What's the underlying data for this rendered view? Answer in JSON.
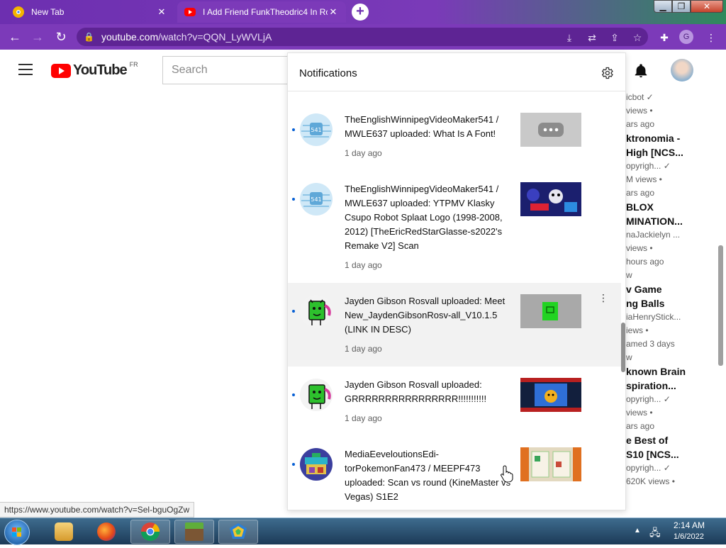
{
  "browser": {
    "tabs": [
      {
        "title": "New Tab",
        "favicon": "chrome-newtab-icon"
      },
      {
        "title": "I Add Friend FunkTheodric4 In Ro",
        "favicon": "youtube-icon"
      }
    ],
    "url_prefix": "youtube.com",
    "url_path": "/watch?v=QQN_LyWVLjA",
    "profile_initial": "G",
    "accent": "#7c3ab9"
  },
  "youtube": {
    "logo_text": "YouTube",
    "country_code": "FR",
    "search_placeholder": "Search"
  },
  "notifications": {
    "title": "Notifications",
    "items": [
      {
        "text": "TheEnglishWinnipegVideoMaker541 / MWLE637 uploaded: What Is A Font!",
        "time": "1 day ago",
        "channel_icon": "globe-channel-icon",
        "thumb_icon": "ellipsis-placeholder-icon"
      },
      {
        "text": "TheEnglishWinnipegVideoMaker541 / MWLE637 uploaded: YTPMV Klasky Csupo Robot Splaat Logo (1998-2008, 2012) [TheEricRedStarGlasse-s2022's Remake V2] Scan",
        "time": "1 day ago",
        "channel_icon": "globe-channel-icon",
        "thumb_icon": "video-thumbnail"
      },
      {
        "text": "Jayden Gibson Rosvall uploaded: Meet New_JaydenGibsonRosv-all_V10.1.5 (LINK IN DESC)",
        "time": "1 day ago",
        "channel_icon": "green-character-channel-icon",
        "thumb_icon": "video-thumbnail"
      },
      {
        "text": "Jayden Gibson Rosvall uploaded: GRRRRRRRRRRRRRRRR!!!!!!!!!!!",
        "time": "1 day ago",
        "channel_icon": "green-character-channel-icon",
        "thumb_icon": "video-thumbnail"
      },
      {
        "text": "MediaEeveloutionsEdi-torPokemonFan473 / MEEPF473 uploaded: Scan vs round (KineMaster vs Vegas) S1E2",
        "time": "",
        "channel_icon": "pixel-art-channel-icon",
        "thumb_icon": "video-thumbnail"
      }
    ]
  },
  "recommendations": [
    {
      "line": "icbot ✓",
      "kind": "meta"
    },
    {
      "line": "views •",
      "kind": "meta"
    },
    {
      "line": "ars ago",
      "kind": "meta"
    },
    {
      "line": "ktronomia -",
      "kind": "title"
    },
    {
      "line": "High [NCS...",
      "kind": "title"
    },
    {
      "line": "opyrigh... ✓",
      "kind": "meta"
    },
    {
      "line": "M views •",
      "kind": "meta"
    },
    {
      "line": "ars ago",
      "kind": "meta"
    },
    {
      "line": "BLOX",
      "kind": "title"
    },
    {
      "line": "MINATION...",
      "kind": "title"
    },
    {
      "line": "naJackielyn ...",
      "kind": "meta"
    },
    {
      "line": " views •",
      "kind": "meta"
    },
    {
      "line": "hours ago",
      "kind": "meta"
    },
    {
      "line": "w",
      "kind": "meta"
    },
    {
      "line": "v Game",
      "kind": "title"
    },
    {
      "line": "ng Balls",
      "kind": "title"
    },
    {
      "line": "iaHenryStick...",
      "kind": "meta"
    },
    {
      "line": "iews •",
      "kind": "meta"
    },
    {
      "line": "amed 3 days",
      "kind": "meta"
    },
    {
      "line": "w",
      "kind": "meta"
    },
    {
      "line": "known Brain",
      "kind": "title"
    },
    {
      "line": "spiration...",
      "kind": "title"
    },
    {
      "line": "opyrigh... ✓",
      "kind": "meta"
    },
    {
      "line": "views •",
      "kind": "meta"
    },
    {
      "line": "ars ago",
      "kind": "meta"
    },
    {
      "line": "e Best of",
      "kind": "title"
    },
    {
      "line": "S10 [NCS...",
      "kind": "title"
    },
    {
      "line": "opyrigh... ✓",
      "kind": "meta"
    },
    {
      "line": "620K views •",
      "kind": "meta"
    }
  ],
  "status_url": "https://www.youtube.com/watch?v=Sel-bguOgZw",
  "taskbar": {
    "apps": [
      "file-explorer-icon",
      "firefox-icon",
      "chrome-icon",
      "minecraft-icon",
      "app-icon"
    ],
    "time": "2:14 AM",
    "date": "1/6/2022"
  }
}
